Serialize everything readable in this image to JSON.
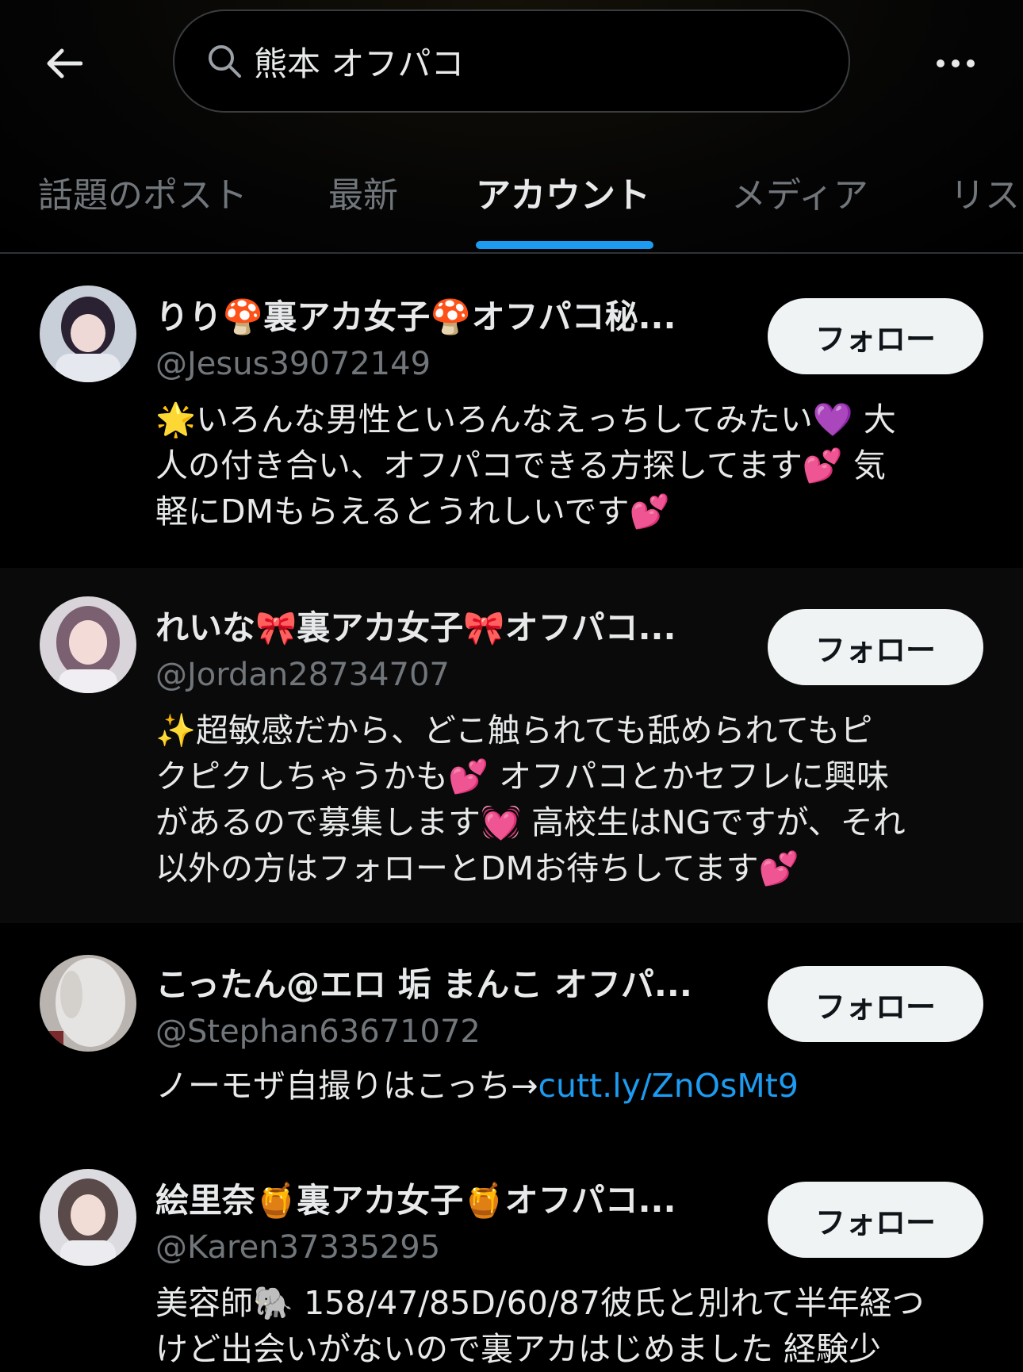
{
  "search": {
    "query": "熊本 オフパコ"
  },
  "tabs": [
    {
      "label": "話題のポスト"
    },
    {
      "label": "最新"
    },
    {
      "label": "アカウント"
    },
    {
      "label": "メディア"
    },
    {
      "label": "リス"
    }
  ],
  "accounts": [
    {
      "name": "りり🍄裏アカ女子🍄オフパコ秘...",
      "handle": "@Jesus39072149",
      "bio": [
        "🌟いろんな男性といろんなえっちしてみたい💜 大",
        "人の付き合い、オフパコできる方探してます💕 気",
        "軽にDMもらえるとうれしいです💕"
      ],
      "follow_label": "フォロー"
    },
    {
      "name": "れいな🎀裏アカ女子🎀オフパコ...",
      "handle": "@Jordan28734707",
      "bio": [
        "✨超敏感だから、どこ触られても舐められてもピ",
        "クピクしちゃうかも💕 オフパコとかセフレに興味",
        "があるので募集します💓 高校生はNGですが、それ",
        "以外の方はフォローとDMお待ちしてます💕"
      ],
      "follow_label": "フォロー"
    },
    {
      "name": "こったん@エロ 垢 まんこ オフパ...",
      "handle": "@Stephan63671072",
      "bio_text": "ノーモザ自撮りはこっち→",
      "bio_link": "cutt.ly/ZnOsMt9",
      "follow_label": "フォロー"
    },
    {
      "name": "絵里奈🍯裏アカ女子🍯オフパコ...",
      "handle": "@Karen37335295",
      "bio": [
        "美容師🐘 158/47/85D/60/87彼氏と別れて半年経つ",
        "けど出会いがないので裏アカはじめました 経験少"
      ],
      "follow_label": "フォロー"
    }
  ]
}
